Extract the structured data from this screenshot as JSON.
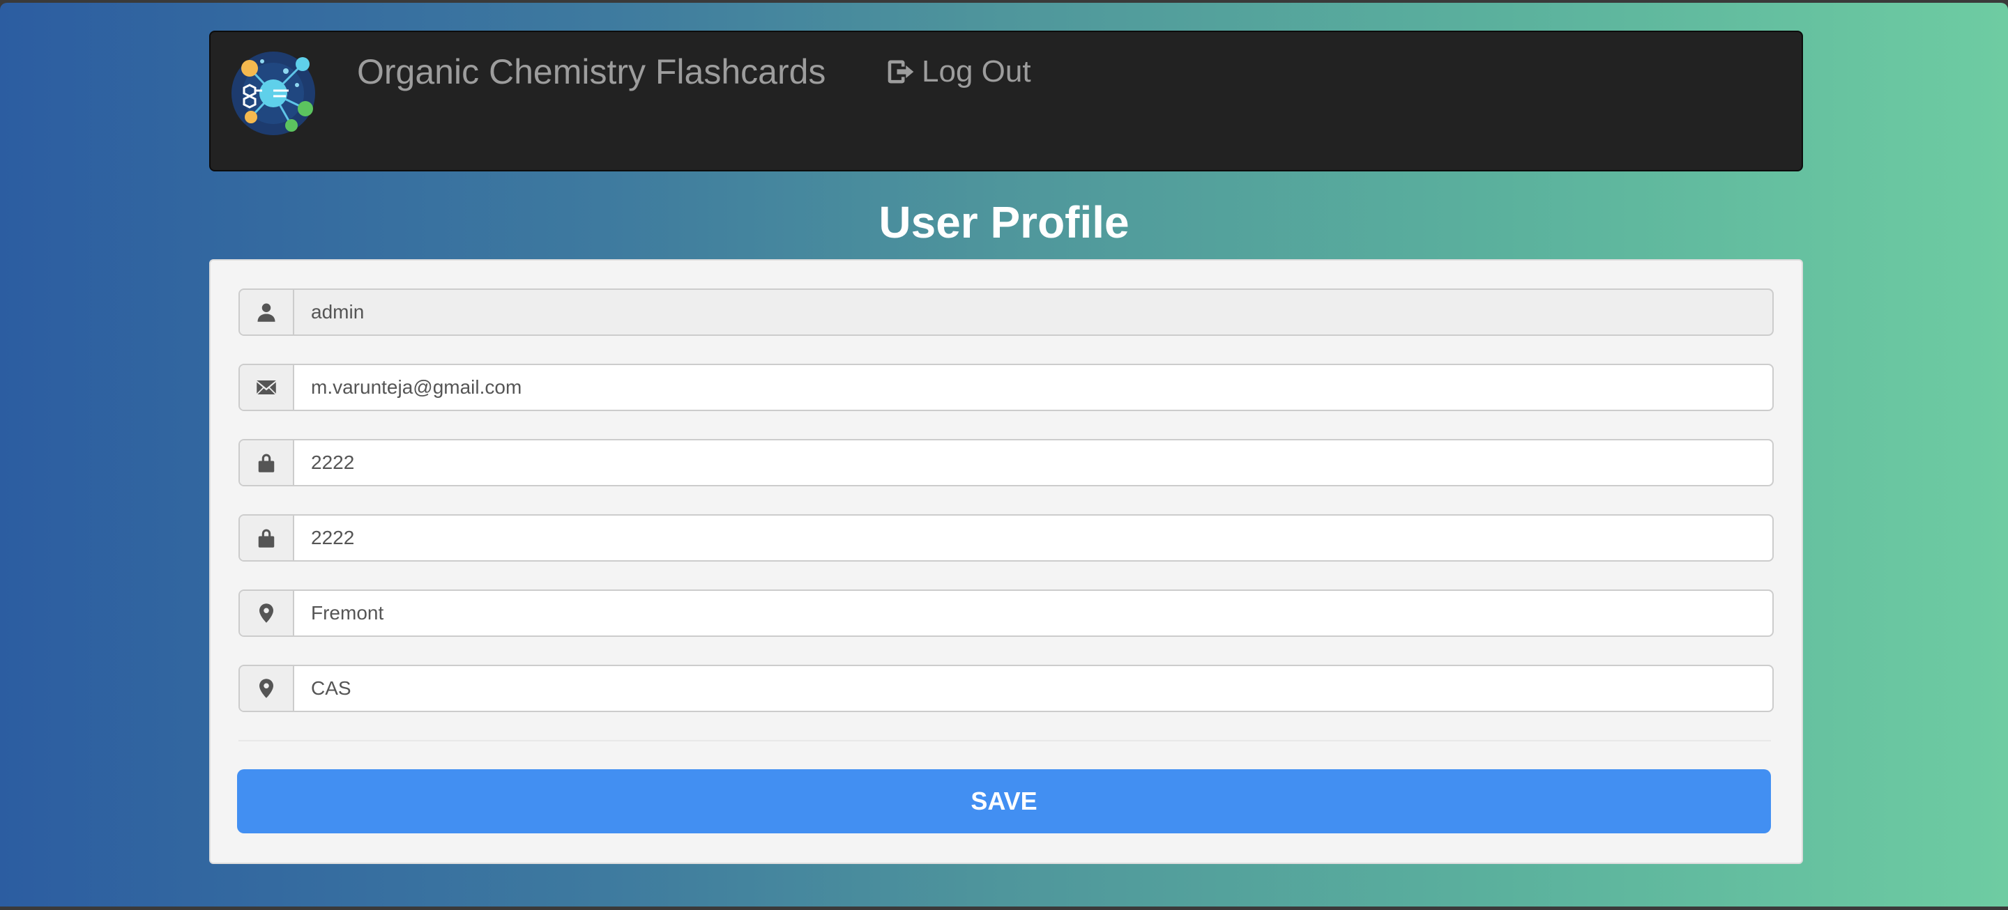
{
  "navbar": {
    "brand": "Organic Chemistry Flashcards",
    "logout_label": "Log Out",
    "logo_icon": "molecule-logo-icon"
  },
  "page": {
    "title": "User Profile"
  },
  "form": {
    "username": {
      "value": "admin",
      "icon": "user-icon",
      "readonly": true
    },
    "email": {
      "value": "m.varunteja@gmail.com",
      "icon": "envelope-icon"
    },
    "password": {
      "value": "2222",
      "icon": "lock-icon"
    },
    "confirm_password": {
      "value": "2222",
      "icon": "lock-icon"
    },
    "city": {
      "value": "Fremont",
      "icon": "map-marker-icon"
    },
    "school": {
      "value": "CAS",
      "icon": "map-marker-icon"
    },
    "save_label": "SAVE"
  },
  "colors": {
    "navbar_bg": "#222222",
    "save_button": "#428ff2",
    "gradient_start": "#2c5da1",
    "gradient_end": "#6ecca2"
  }
}
